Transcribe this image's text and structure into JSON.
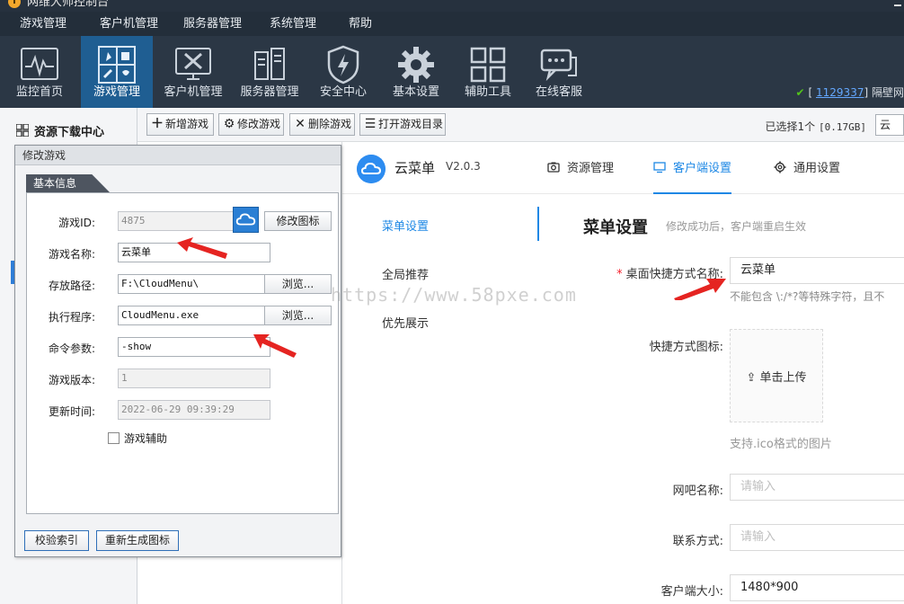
{
  "window": {
    "title": "网维大师控制台"
  },
  "menu": [
    "游戏管理",
    "客户机管理",
    "服务器管理",
    "系统管理",
    "帮助"
  ],
  "toolbar": {
    "items": [
      {
        "label": "监控首页",
        "icon": "monitor-pulse-icon"
      },
      {
        "label": "游戏管理",
        "icon": "game-controller-icon",
        "active": true
      },
      {
        "label": "客户机管理",
        "icon": "client-tools-icon"
      },
      {
        "label": "服务器管理",
        "icon": "server-icon"
      },
      {
        "label": "安全中心",
        "icon": "shield-bolt-icon"
      },
      {
        "label": "基本设置",
        "icon": "gear-icon"
      },
      {
        "label": "辅助工具",
        "icon": "grid-tools-icon"
      },
      {
        "label": "在线客服",
        "icon": "chat-icon"
      }
    ],
    "status": {
      "prefix": "[",
      "qq": "1129337",
      "suffix": "]",
      "site": "隔壁网"
    }
  },
  "left_panel": {
    "title": "资源下载中心"
  },
  "actions": {
    "add": "新增游戏",
    "edit": "修改游戏",
    "delete": "删除游戏",
    "open_dir": "打开游戏目录",
    "selected": "已选择1个",
    "size": "[0.17GB]",
    "combo": "云"
  },
  "dialog": {
    "title": "修改游戏",
    "tab": "基本信息",
    "fields": {
      "game_id": {
        "label": "游戏ID:",
        "value": "4875"
      },
      "game_name": {
        "label": "游戏名称:",
        "value": "云菜单"
      },
      "path": {
        "label": "存放路径:",
        "value": "F:\\CloudMenu\\"
      },
      "exe": {
        "label": "执行程序:",
        "value": "CloudMenu.exe"
      },
      "args": {
        "label": "命令参数:",
        "value": "-show"
      },
      "version": {
        "label": "游戏版本:",
        "value": "1"
      },
      "updated": {
        "label": "更新时间:",
        "value": "2022-06-29 09:39:29"
      }
    },
    "buttons": {
      "change_icon": "修改图标",
      "browse": "浏览...",
      "verify_index": "校验索引",
      "regen_icon": "重新生成图标"
    },
    "checkbox": "游戏辅助"
  },
  "web": {
    "brand": "云菜单",
    "version": "V2.0.3",
    "tabs": [
      "资源管理",
      "客户端设置",
      "通用设置"
    ],
    "side_menu": [
      "菜单设置",
      "全局推荐",
      "优先展示"
    ],
    "section_title": "菜单设置",
    "section_sub": "修改成功后，客户端重启生效",
    "form": {
      "shortcut_name": {
        "label": "桌面快捷方式名称:",
        "value": "云菜单",
        "hint": "不能包含 \\:/*?等特殊字符，且不"
      },
      "shortcut_icon": {
        "label": "快捷方式图标:",
        "upload": "单击上传",
        "hint": "支持.ico格式的图片"
      },
      "cafe_name": {
        "label": "网吧名称:",
        "placeholder": "请输入"
      },
      "contact": {
        "label": "联系方式:",
        "placeholder": "请输入"
      },
      "client_size": {
        "label": "客户端大小:",
        "value": "1480*900"
      }
    }
  },
  "watermark": "https://www.58pxe.com",
  "colors": {
    "accent": "#1e88e5",
    "toolbar_bg": "#2b3745",
    "arrow": "#e52421"
  }
}
